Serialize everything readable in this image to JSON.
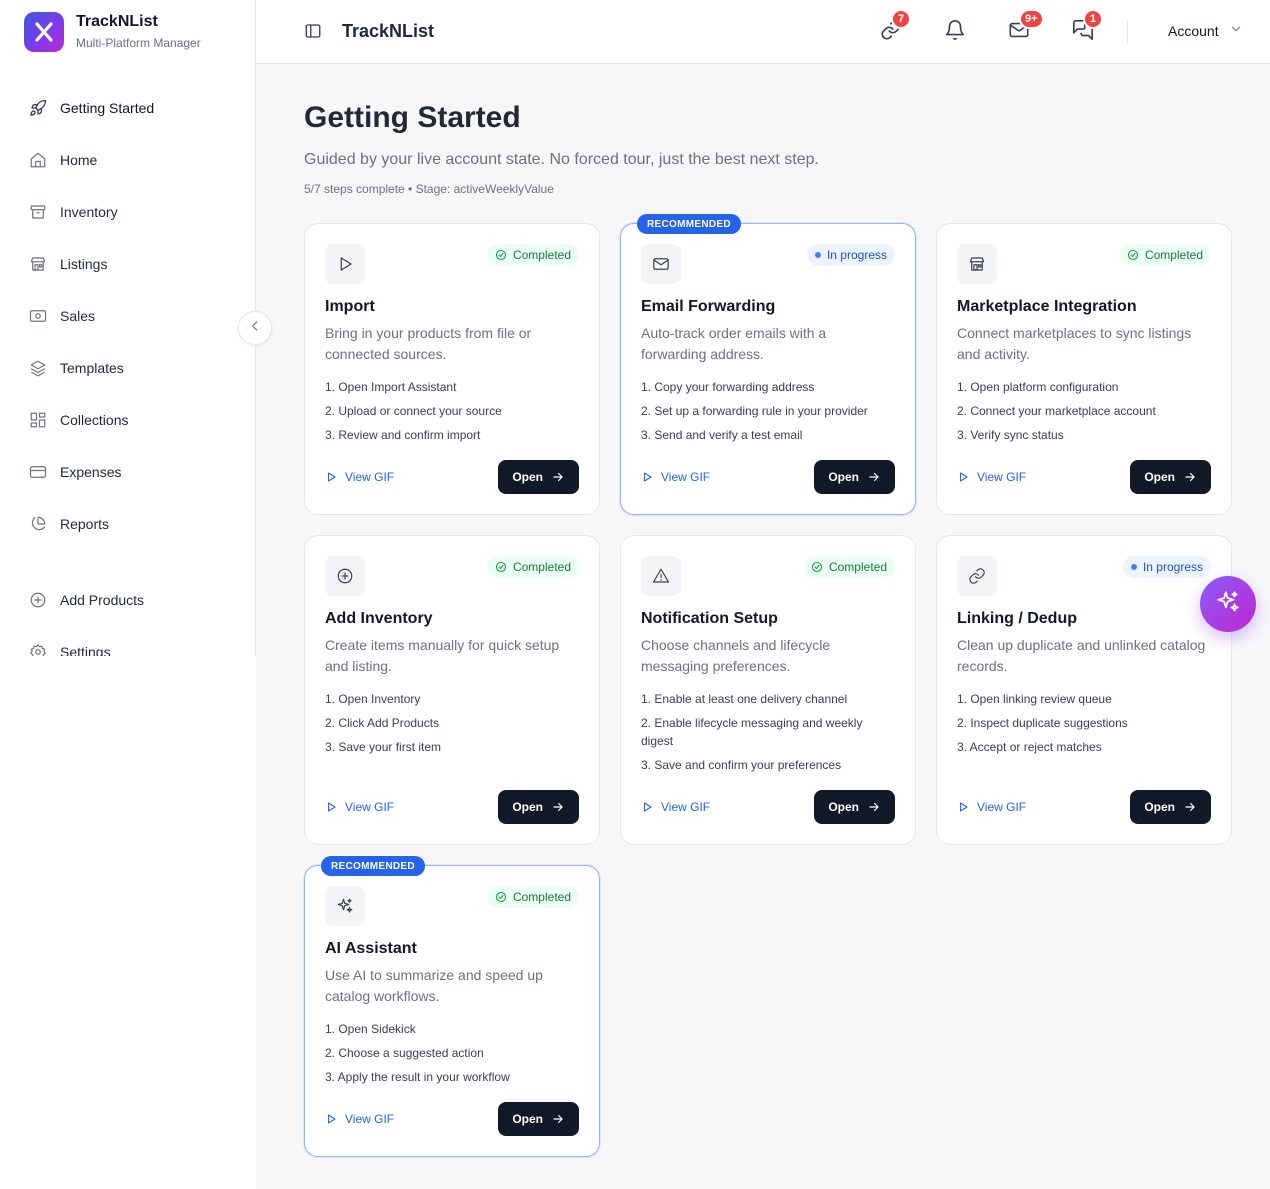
{
  "app": {
    "name": "TrackNList",
    "subtitle": "Multi-Platform Manager"
  },
  "sidebar": {
    "items": [
      {
        "label": "Getting Started",
        "icon": "rocket-icon",
        "active": true
      },
      {
        "label": "Home",
        "icon": "home-icon"
      },
      {
        "label": "Inventory",
        "icon": "archive-icon"
      },
      {
        "label": "Listings",
        "icon": "store-icon"
      },
      {
        "label": "Sales",
        "icon": "banknote-icon"
      },
      {
        "label": "Templates",
        "icon": "layers-icon"
      },
      {
        "label": "Collections",
        "icon": "grid-icon"
      },
      {
        "label": "Expenses",
        "icon": "credit-card-icon"
      },
      {
        "label": "Reports",
        "icon": "pie-chart-icon"
      },
      {
        "label": "Add Products",
        "icon": "plus-circle-icon"
      },
      {
        "label": "Settings",
        "icon": "gear-icon"
      }
    ]
  },
  "header": {
    "title": "TrackNList",
    "badges": {
      "links": "7",
      "mail": "9+",
      "messages": "1"
    },
    "account_label": "Account"
  },
  "main": {
    "title": "Getting Started",
    "subtitle": "Guided by your live account state. No forced tour, just the best next step.",
    "progress": "5/7 steps complete • Stage: activeWeeklyValue",
    "progress_value": {
      "complete": 5,
      "total": 7
    }
  },
  "labels": {
    "recommended": "RECOMMENDED",
    "completed": "Completed",
    "in_progress": "In progress",
    "view_gif": "View GIF",
    "open": "Open"
  },
  "cards": [
    {
      "title": "Import",
      "description": "Bring in your products from file or connected sources.",
      "status": "Completed",
      "recommended": false,
      "icon": "play-icon",
      "steps": [
        "1. Open Import Assistant",
        "2. Upload or connect your source",
        "3. Review and confirm import"
      ]
    },
    {
      "title": "Email Forwarding",
      "description": "Auto-track order emails with a forwarding address.",
      "status": "In progress",
      "recommended": true,
      "icon": "mail-icon",
      "steps": [
        "1. Copy your forwarding address",
        "2. Set up a forwarding rule in your provider",
        "3. Send and verify a test email"
      ]
    },
    {
      "title": "Marketplace Integration",
      "description": "Connect marketplaces to sync listings and activity.",
      "status": "Completed",
      "recommended": false,
      "icon": "store-icon",
      "steps": [
        "1. Open platform configuration",
        "2. Connect your marketplace account",
        "3. Verify sync status"
      ]
    },
    {
      "title": "Add Inventory",
      "description": "Create items manually for quick setup and listing.",
      "status": "Completed",
      "recommended": false,
      "icon": "plus-circle-icon",
      "steps": [
        "1. Open Inventory",
        "2. Click Add Products",
        "3. Save your first item"
      ]
    },
    {
      "title": "Notification Setup",
      "description": "Choose channels and lifecycle messaging preferences.",
      "status": "Completed",
      "recommended": false,
      "icon": "warning-icon",
      "steps": [
        "1. Enable at least one delivery channel",
        "2. Enable lifecycle messaging and weekly digest",
        "3. Save and confirm your preferences"
      ]
    },
    {
      "title": "Linking / Dedup",
      "description": "Clean up duplicate and unlinked catalog records.",
      "status": "In progress",
      "recommended": false,
      "icon": "link-icon",
      "steps": [
        "1. Open linking review queue",
        "2. Inspect duplicate suggestions",
        "3. Accept or reject matches"
      ]
    },
    {
      "title": "AI Assistant",
      "description": "Use AI to summarize and speed up catalog workflows.",
      "status": "Completed",
      "recommended": true,
      "icon": "sparkles-icon",
      "steps": [
        "1. Open Sidekick",
        "2. Choose a suggested action",
        "3. Apply the result in your workflow"
      ]
    }
  ]
}
